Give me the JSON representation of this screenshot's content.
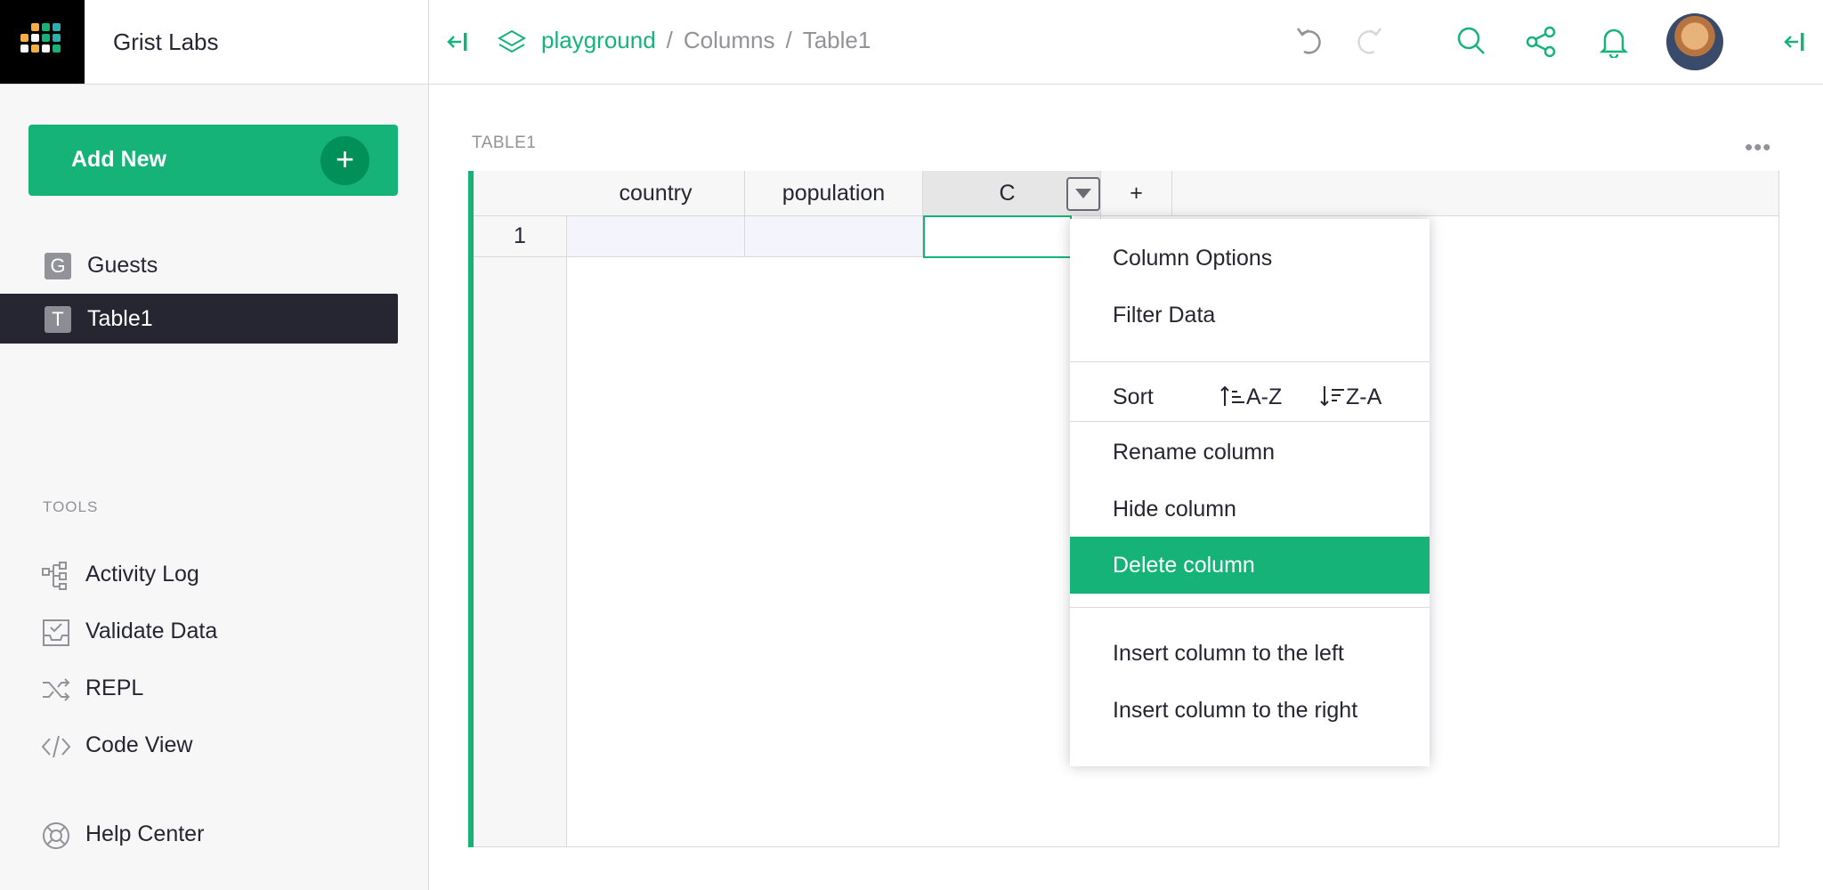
{
  "org": {
    "name": "Grist Labs"
  },
  "sidebar": {
    "add_new": "Add New",
    "pages": [
      {
        "badge": "G",
        "label": "Guests"
      },
      {
        "badge": "T",
        "label": "Table1"
      }
    ],
    "tools_title": "TOOLS",
    "tools": [
      {
        "icon": "activity-log-icon",
        "label": "Activity Log"
      },
      {
        "icon": "validate-data-icon",
        "label": "Validate Data"
      },
      {
        "icon": "repl-icon",
        "label": "REPL"
      },
      {
        "icon": "code-view-icon",
        "label": "Code View"
      }
    ],
    "help": "Help Center"
  },
  "breadcrumb": {
    "doc": "playground",
    "sep": "/",
    "page": "Columns",
    "table": "Table1"
  },
  "section": {
    "title": "TABLE1",
    "more": "•••"
  },
  "grid": {
    "columns": [
      "country",
      "population",
      "C"
    ],
    "add_column": "+",
    "rows": [
      {
        "num": "1",
        "cells": [
          "",
          "",
          ""
        ]
      }
    ]
  },
  "menu": {
    "column_options": "Column Options",
    "filter_data": "Filter Data",
    "sort_label": "Sort",
    "sort_asc": "A-Z",
    "sort_desc": "Z-A",
    "rename": "Rename column",
    "hide": "Hide column",
    "delete": "Delete column",
    "insert_left": "Insert column to the left",
    "insert_right": "Insert column to the right"
  },
  "colors": {
    "accent": "#16b378",
    "dark": "#262633",
    "muted": "#929299"
  }
}
